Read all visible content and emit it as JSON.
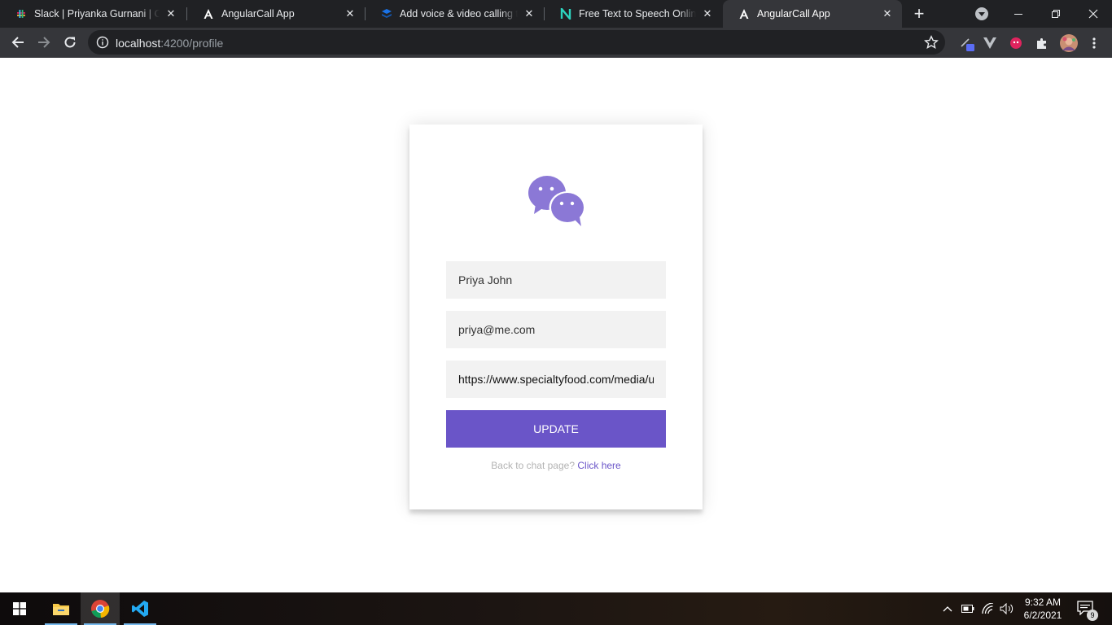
{
  "browser": {
    "tabs": [
      {
        "title": "Slack | Priyanka Gurnani | Con",
        "icon": "slack-icon"
      },
      {
        "title": "AngularCall App",
        "icon": "angular-icon"
      },
      {
        "title": "Add voice & video calling to y",
        "icon": "stack-icon"
      },
      {
        "title": "Free Text to Speech Online wi",
        "icon": "narakeet-icon"
      },
      {
        "title": "AngularCall App",
        "icon": "angular-icon"
      }
    ],
    "active_tab_index": 4,
    "url_host": "localhost",
    "url_path": ":4200/profile"
  },
  "profile_form": {
    "name_value": "Priya John",
    "email_value": "priya@me.com",
    "avatar_url_value": "https://www.specialtyfood.com/media/u",
    "update_label": "UPDATE",
    "back_text": "Back to chat page?",
    "back_link": "Click here"
  },
  "taskbar": {
    "apps": [
      "windows-start",
      "file-explorer",
      "chrome",
      "vscode"
    ],
    "time": "9:32 AM",
    "date": "6/2/2021",
    "notification_count": "9"
  },
  "colors": {
    "accent": "#6a55c8",
    "logo": "#8b78d6",
    "field_bg": "#f2f2f2"
  }
}
